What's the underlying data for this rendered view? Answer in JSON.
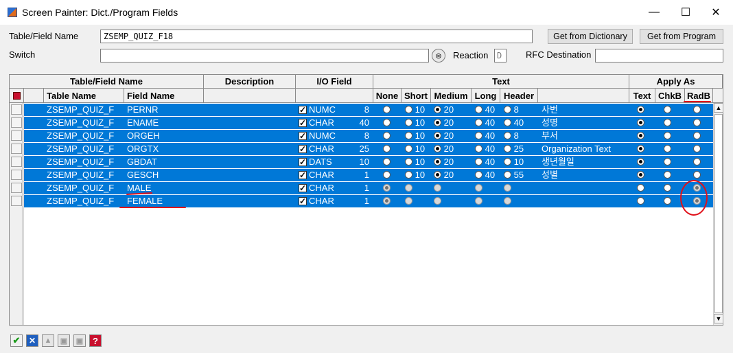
{
  "window": {
    "title": "Screen Painter: Dict./Program Fields",
    "minimize": "—",
    "maximize": "☐",
    "close": "✕"
  },
  "header": {
    "table_field_label": "Table/Field Name",
    "table_field_value": "ZSEMP_QUIZ_F18",
    "switch_label": "Switch",
    "switch_value": "",
    "reaction_label": "Reaction",
    "reaction_value": "D",
    "rfc_label": "RFC Destination",
    "rfc_value": "",
    "get_dict_button": "Get from Dictionary",
    "get_program_button": "Get from Program"
  },
  "table": {
    "group_headers": {
      "table_field": "Table/Field Name",
      "description": "Description",
      "io_field": "I/O Field",
      "text": "Text",
      "apply_as": "Apply As"
    },
    "columns": {
      "table_name": "Table Name",
      "field_name": "Field Name",
      "none": "None",
      "short": "Short",
      "medium": "Medium",
      "long": "Long",
      "header": "Header",
      "apply_text": "Text",
      "apply_chkb": "ChkB",
      "apply_radb": "RadB"
    },
    "rows": [
      {
        "table": "ZSEMP_QUIZ_F",
        "field": "PERNR",
        "type": "NUMC",
        "len": "8",
        "short": "10",
        "medium": "20",
        "long": "40",
        "header": "8",
        "text": "사번",
        "text_sel": "medium",
        "apply": "text",
        "enabled": true
      },
      {
        "table": "ZSEMP_QUIZ_F",
        "field": "ENAME",
        "type": "CHAR",
        "len": "40",
        "short": "10",
        "medium": "20",
        "long": "40",
        "header": "40",
        "text": "성명",
        "text_sel": "medium",
        "apply": "text",
        "enabled": true
      },
      {
        "table": "ZSEMP_QUIZ_F",
        "field": "ORGEH",
        "type": "NUMC",
        "len": "8",
        "short": "10",
        "medium": "20",
        "long": "40",
        "header": "8",
        "text": "부서",
        "text_sel": "medium",
        "apply": "text",
        "enabled": true
      },
      {
        "table": "ZSEMP_QUIZ_F",
        "field": "ORGTX",
        "type": "CHAR",
        "len": "25",
        "short": "10",
        "medium": "20",
        "long": "40",
        "header": "25",
        "text": "Organization Text",
        "text_sel": "medium",
        "apply": "text",
        "enabled": true
      },
      {
        "table": "ZSEMP_QUIZ_F",
        "field": "GBDAT",
        "type": "DATS",
        "len": "10",
        "short": "10",
        "medium": "20",
        "long": "40",
        "header": "10",
        "text": "생년월일",
        "text_sel": "medium",
        "apply": "text",
        "enabled": true
      },
      {
        "table": "ZSEMP_QUIZ_F",
        "field": "GESCH",
        "type": "CHAR",
        "len": "1",
        "short": "10",
        "medium": "20",
        "long": "40",
        "header": "55",
        "text": "성별",
        "text_sel": "medium",
        "apply": "text",
        "enabled": true
      },
      {
        "table": "ZSEMP_QUIZ_F",
        "field": "MALE",
        "type": "CHAR",
        "len": "1",
        "short": "",
        "medium": "",
        "long": "",
        "header": "",
        "text": "",
        "text_sel": "none",
        "apply": "radb",
        "enabled": false
      },
      {
        "table": "ZSEMP_QUIZ_F",
        "field": "FEMALE",
        "type": "CHAR",
        "len": "1",
        "short": "",
        "medium": "",
        "long": "",
        "header": "",
        "text": "",
        "text_sel": "none",
        "apply": "radb",
        "enabled": false
      }
    ]
  },
  "toolbar": {
    "items": [
      "check-icon",
      "cancel-icon",
      "tree-icon",
      "save-icon",
      "save-local-icon",
      "help-icon"
    ]
  },
  "colors": {
    "selection": "#0078d7",
    "annotation": "#e0101a"
  }
}
